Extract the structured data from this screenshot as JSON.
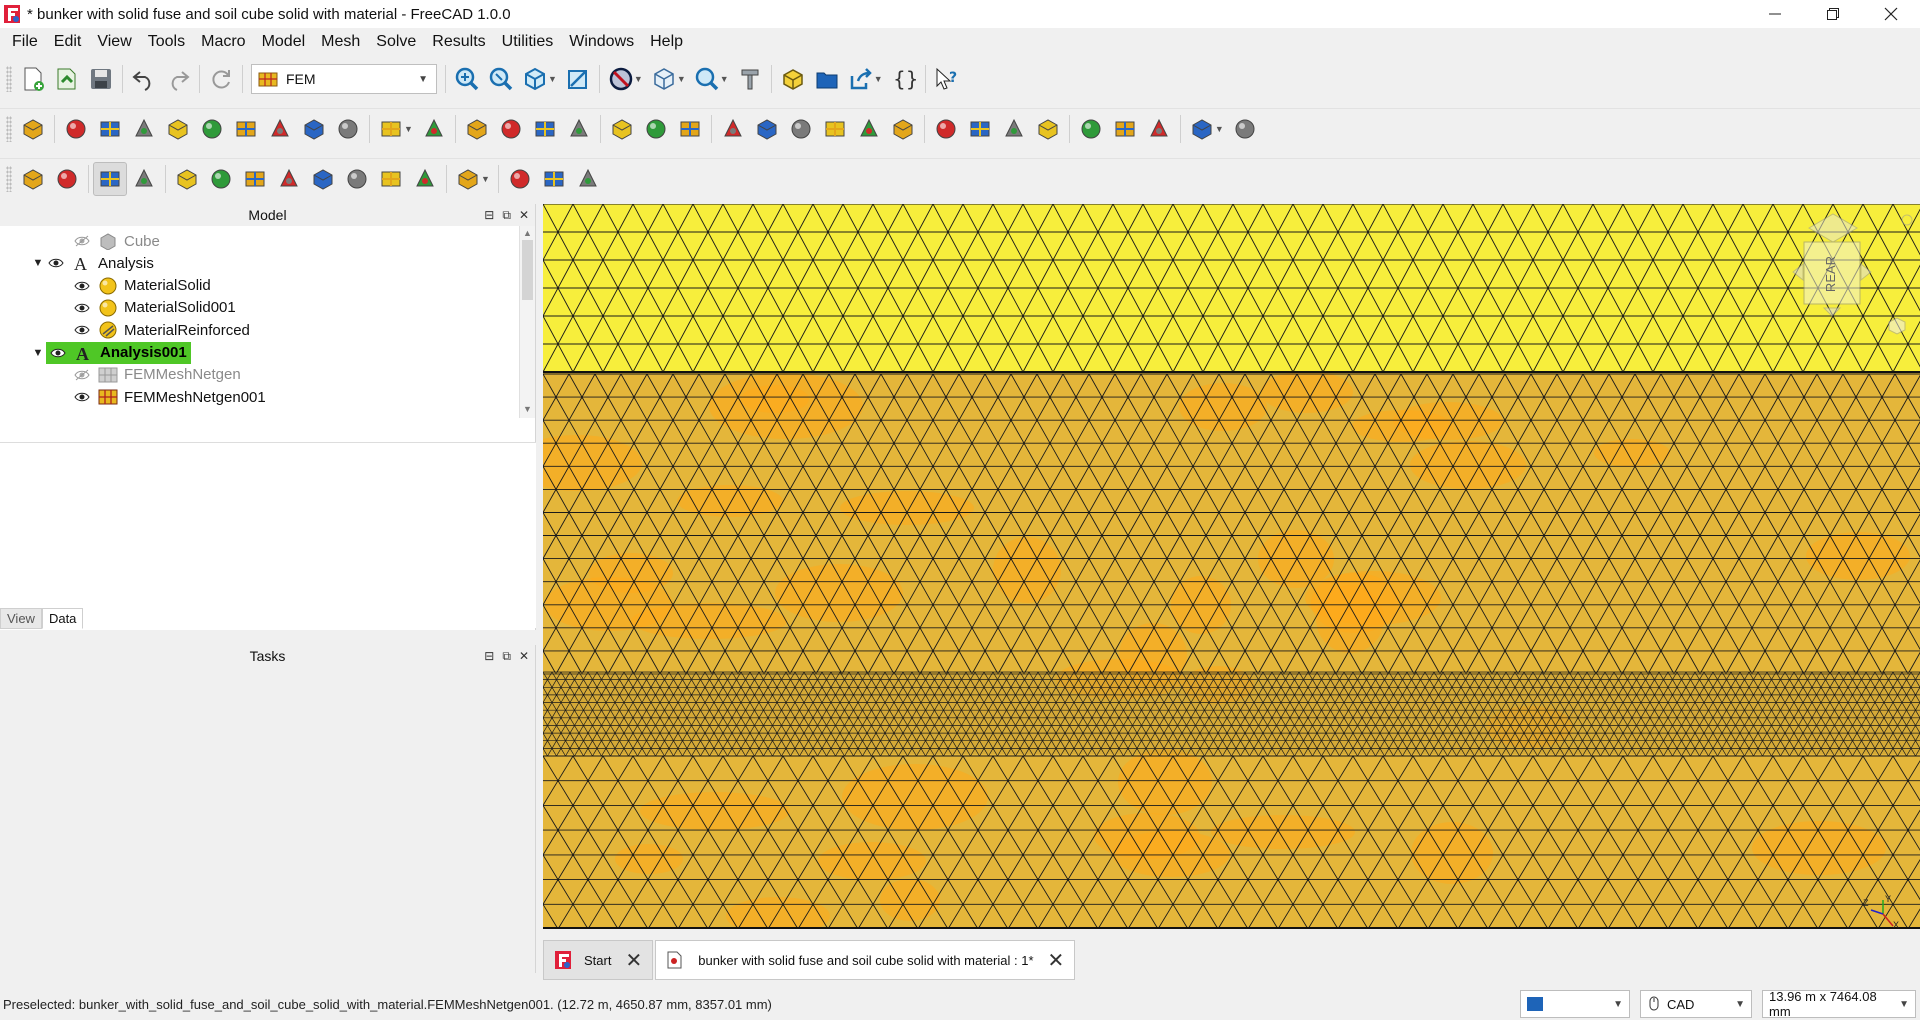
{
  "window": {
    "title": "* bunker with solid fuse and soil cube solid with material - FreeCAD 1.0.0",
    "controls": [
      "minimize",
      "restore",
      "close"
    ]
  },
  "menu": [
    "File",
    "Edit",
    "View",
    "Tools",
    "Macro",
    "Model",
    "Mesh",
    "Solve",
    "Results",
    "Utilities",
    "Windows",
    "Help"
  ],
  "toolbar": {
    "workbench": "FEM",
    "row1_icons": [
      "new-document-icon",
      "open-icon",
      "save-icon",
      "undo-icon",
      "redo-icon",
      "refresh-icon",
      "fit-all-icon",
      "fit-selection-icon",
      "isometric-icon",
      "view-section-icon",
      "draw-style-icon",
      "std-views-icon",
      "measure-icon",
      "axonometric-icon",
      "part-icon",
      "group-icon",
      "link-icon",
      "macro-braces-icon",
      "whats-this-icon"
    ],
    "row2_icons": [
      "analysis-icon",
      "material-solid-icon",
      "material-fluid-icon",
      "material-nonlinear-icon",
      "material-reinforced-icon",
      "material-editor-icon",
      "element-geometry-icon",
      "beam-section-icon",
      "shell-thickness-icon",
      "rotation-icon",
      "constraint-menu-icon",
      "fluid-section-icon",
      "body-heat-icon",
      "initial-temperature-icon",
      "constraint-fixed-icon",
      "displacement-icon",
      "contact-icon",
      "tie-icon",
      "spring-icon",
      "force-icon",
      "pressure-icon",
      "centrif-icon",
      "self-weight-icon",
      "temperature-icon",
      "heatflux-icon",
      "heat-source-icon",
      "netgen-icon",
      "gmsh-icon",
      "mesh-boundary-icon",
      "mesh-region-icon",
      "mesh-group-icon",
      "mesh-clear-icon",
      "sketch-icon",
      "results-icon"
    ],
    "row3_icons": [
      "solver-run-icon",
      "bar-icon",
      "refresh-view-icon",
      "grid-icon",
      "line-icon",
      "box-icon",
      "surface-icon",
      "cylinder-icon",
      "shell-icon",
      "hatch-icon",
      "clip-icon",
      "filter-icon",
      "sphere-color-icon",
      "post-pipeline-icon",
      "post-warp-icon",
      "post-scalar-icon"
    ]
  },
  "model_panel": {
    "title": "Model",
    "tree": [
      {
        "label": "Cube",
        "depth": 1,
        "arrow": "",
        "visible": false,
        "dim": true,
        "icon": "cube-icon"
      },
      {
        "label": "Analysis",
        "depth": 0,
        "arrow": "▼",
        "visible": true,
        "dim": false,
        "icon": "analysis-icon"
      },
      {
        "label": "MaterialSolid",
        "depth": 1,
        "arrow": "",
        "visible": true,
        "dim": false,
        "icon": "material-icon"
      },
      {
        "label": "MaterialSolid001",
        "depth": 1,
        "arrow": "",
        "visible": true,
        "dim": false,
        "icon": "material-icon"
      },
      {
        "label": "MaterialReinforced",
        "depth": 1,
        "arrow": "",
        "visible": true,
        "dim": false,
        "icon": "material-reinforced-icon"
      },
      {
        "label": "Analysis001",
        "depth": 0,
        "arrow": "▼",
        "visible": true,
        "dim": false,
        "icon": "analysis-icon",
        "selected": true
      },
      {
        "label": "FEMMeshNetgen",
        "depth": 1,
        "arrow": "",
        "visible": false,
        "dim": true,
        "icon": "mesh-icon"
      },
      {
        "label": "FEMMeshNetgen001",
        "depth": 1,
        "arrow": "",
        "visible": true,
        "dim": false,
        "icon": "mesh-icon"
      }
    ],
    "tabs": [
      "View",
      "Data"
    ],
    "active_tab": "Data"
  },
  "tasks_panel": {
    "title": "Tasks"
  },
  "viewport": {
    "navcube_face": "REAR",
    "axis_labels": {
      "z": "Z",
      "y": "Y",
      "x": "X"
    },
    "colors": {
      "top_band": "#f7ee3c",
      "body": "#e4b63a",
      "highlight": "#ffaa1a",
      "mesh_line": "#1a1a1a"
    }
  },
  "doc_tabs": [
    {
      "label": "Start",
      "active": false
    },
    {
      "label": "bunker with solid fuse and soil cube solid with material : 1*",
      "active": true
    }
  ],
  "status": {
    "message": "Preselected: bunker_with_solid_fuse_and_soil_cube_solid_with_material.FEMMeshNetgen001. (12.72 m, 4650.87 mm, 8357.01 mm)",
    "nav_style": "CAD",
    "dimensions": "13.96 m x 7464.08 mm"
  }
}
